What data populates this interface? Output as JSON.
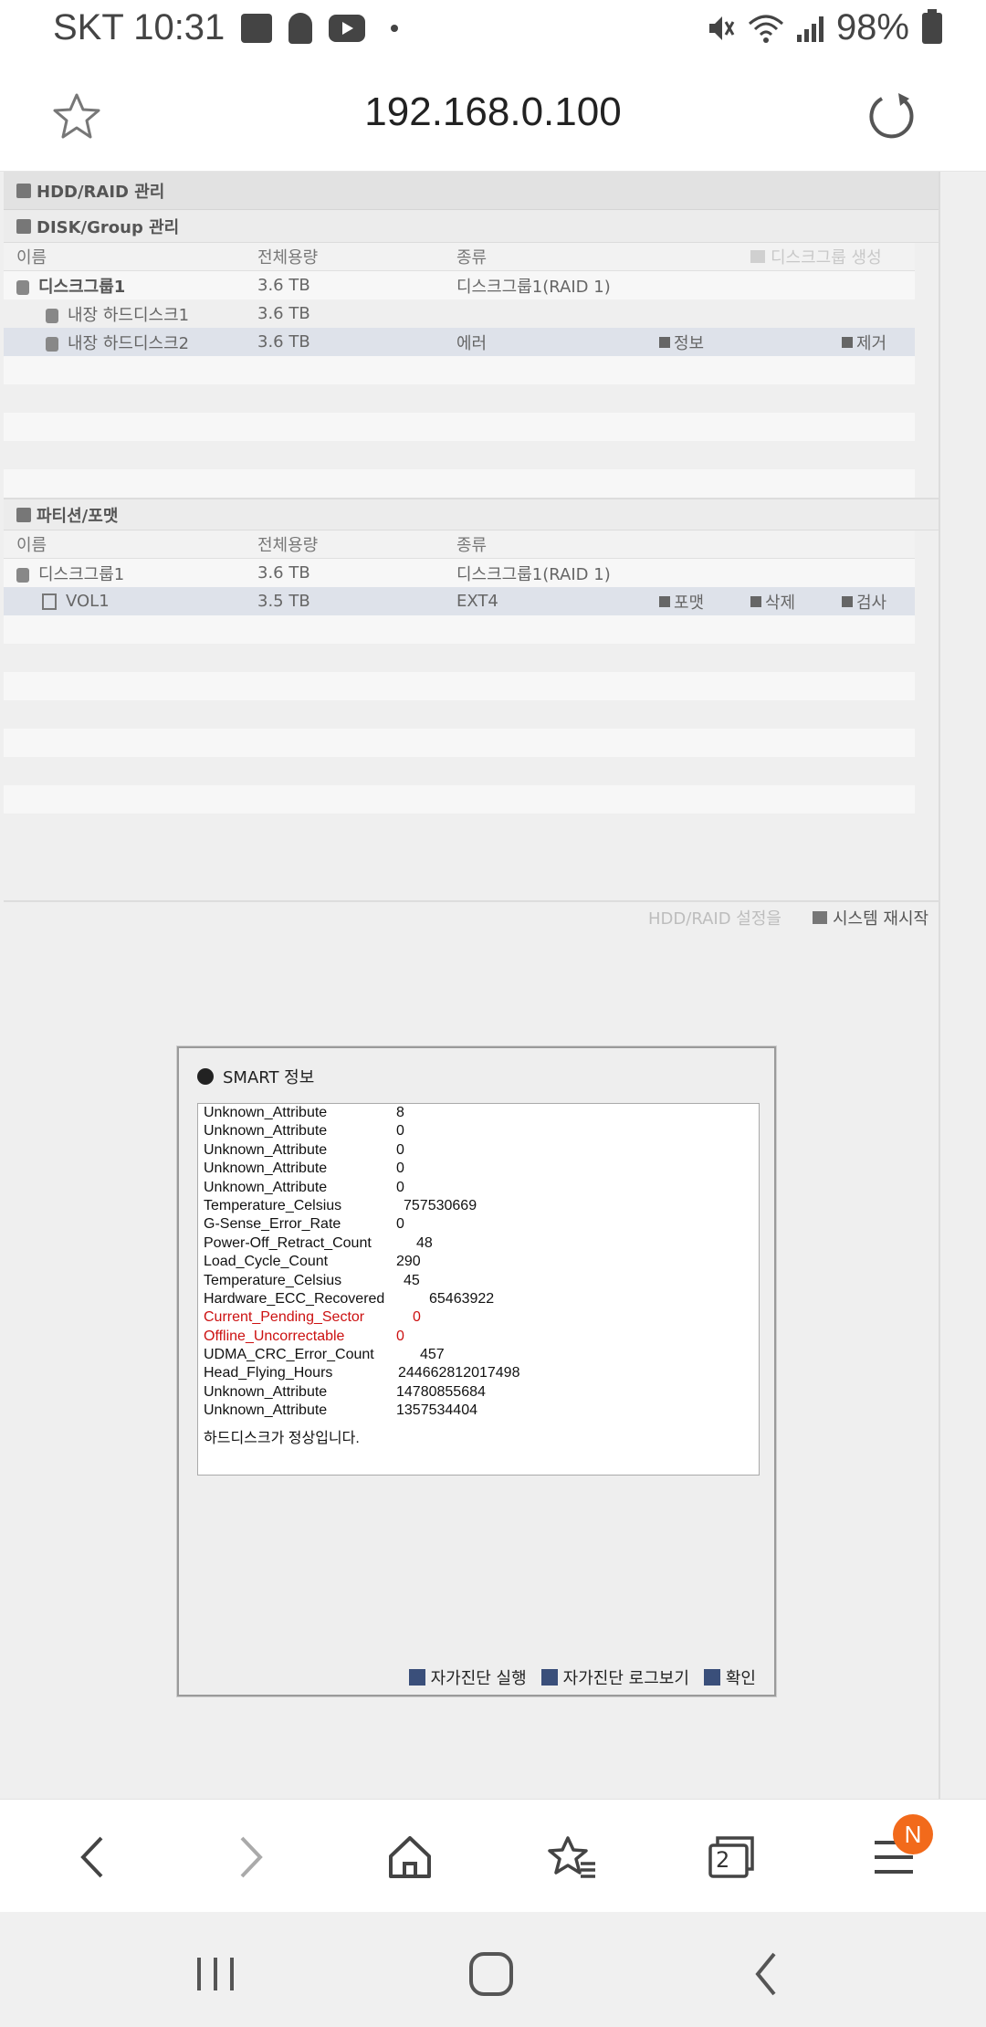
{
  "status_bar": {
    "carrier": "SKT",
    "time": "10:31",
    "battery": "98%"
  },
  "address_bar": {
    "url": "192.168.0.100"
  },
  "hdd_raid": {
    "title": "HDD/RAID 관리",
    "disk_section_title": "DISK/Group 관리",
    "columns": [
      "이름",
      "전체용량",
      "종류"
    ],
    "create_group": "디스크그룹 생성",
    "disk_rows": [
      {
        "name": "디스크그룹1",
        "capacity": "3.6 TB",
        "type": "디스크그룹1(RAID 1)"
      },
      {
        "name": "내장 하드디스크1",
        "capacity": "3.6 TB",
        "type": ""
      },
      {
        "name": "내장 하드디스크2",
        "capacity": "3.6 TB",
        "type": "에러",
        "action_info": "정보",
        "action_remove": "제거"
      }
    ],
    "partition_section_title": "파티션/포맷",
    "partition_rows": [
      {
        "name": "디스크그룹1",
        "capacity": "3.6 TB",
        "type": "디스크그룹1(RAID 1)"
      },
      {
        "name": "VOL1",
        "capacity": "3.5 TB",
        "type": "EXT4",
        "action_format": "포맷",
        "action_delete": "삭제",
        "action_check": "검사"
      }
    ],
    "footer_hint": "HDD/RAID 설정을",
    "restart_label": "시스템 재시작"
  },
  "smart_dialog": {
    "title": "SMART 정보",
    "attributes": [
      {
        "name": "Unknown_Attribute",
        "value": "8",
        "warn": false
      },
      {
        "name": "Unknown_Attribute",
        "value": "0",
        "warn": false
      },
      {
        "name": "Unknown_Attribute",
        "value": "0",
        "warn": false
      },
      {
        "name": "Unknown_Attribute",
        "value": "0",
        "warn": false
      },
      {
        "name": "Unknown_Attribute",
        "value": "0",
        "warn": false
      },
      {
        "name": "Temperature_Celsius",
        "value": "757530669",
        "warn": false
      },
      {
        "name": "G-Sense_Error_Rate",
        "value": "0",
        "warn": false
      },
      {
        "name": "Power-Off_Retract_Count",
        "value": "48",
        "warn": false
      },
      {
        "name": "Load_Cycle_Count",
        "value": "290",
        "warn": false
      },
      {
        "name": "Temperature_Celsius",
        "value": "45",
        "warn": false
      },
      {
        "name": "Hardware_ECC_Recovered",
        "value": "65463922",
        "warn": false
      },
      {
        "name": "Current_Pending_Sector",
        "value": "0",
        "warn": true
      },
      {
        "name": "Offline_Uncorrectable",
        "value": "0",
        "warn": true
      },
      {
        "name": "UDMA_CRC_Error_Count",
        "value": "457",
        "warn": false
      },
      {
        "name": "Head_Flying_Hours",
        "value": "244662812017498",
        "warn": false
      },
      {
        "name": "Unknown_Attribute",
        "value": "14780855684",
        "warn": false
      },
      {
        "name": "Unknown_Attribute",
        "value": "1357534404",
        "warn": false
      }
    ],
    "message": "하드디스크가 정상입니다.",
    "buttons": {
      "self_test": "자가진단 실행",
      "self_test_log": "자가진단 로그보기",
      "ok": "확인"
    }
  },
  "browser_nav": {
    "tab_count": "2",
    "notification_badge": "N"
  }
}
